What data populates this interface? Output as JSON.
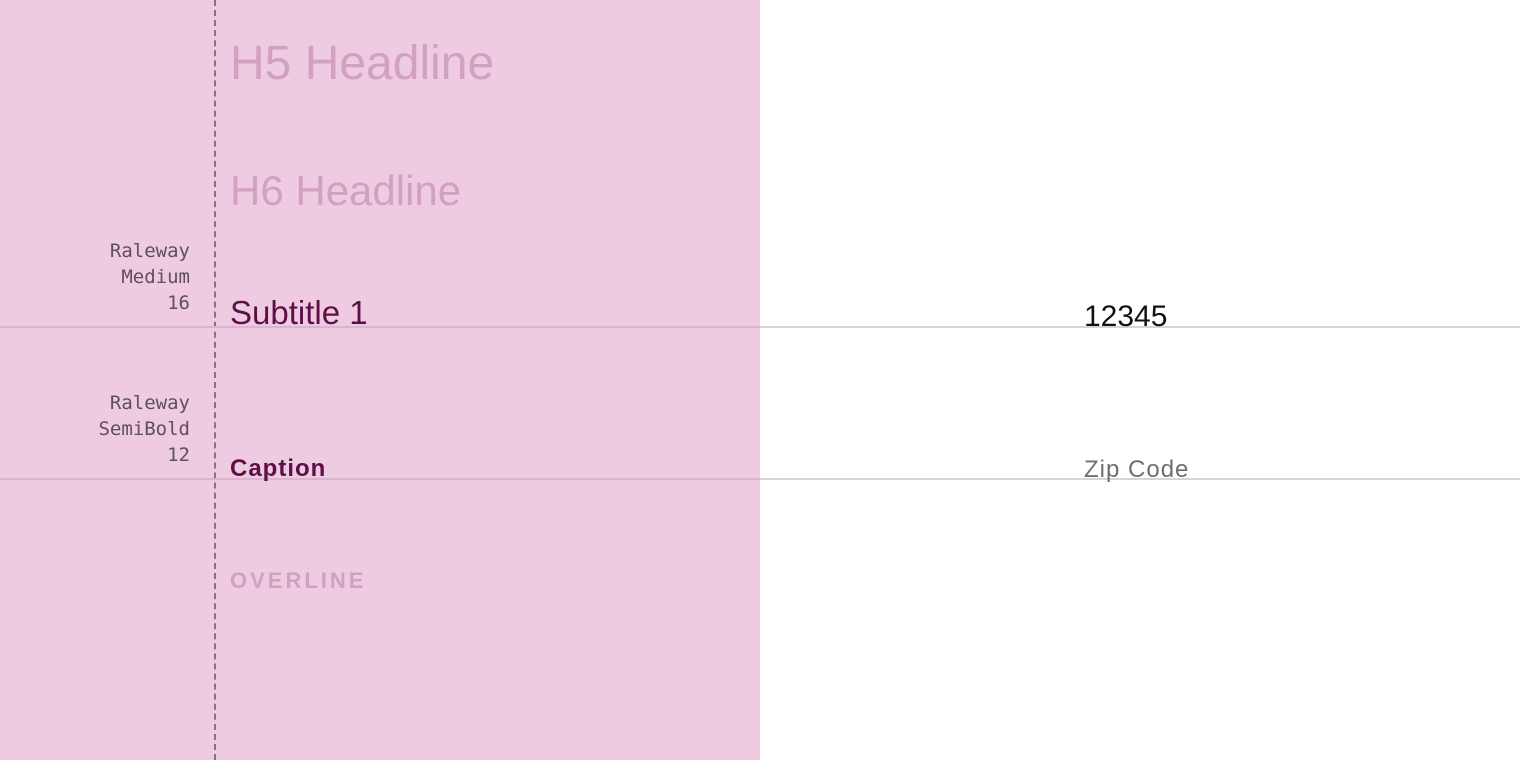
{
  "colors": {
    "panel_background": "#eecbe1",
    "faded_text": "#d2a1c2",
    "emphasized_text": "#5f0f47",
    "spec_text": "#5e5058",
    "guide_line": "#8a7080",
    "value_text": "#111111",
    "label_text": "#6f6f6f"
  },
  "type_scale": {
    "h5": "H5 Headline",
    "h6": "H6 Headline",
    "subtitle1": "Subtitle 1",
    "caption": "Caption",
    "overline": "OVERLINE"
  },
  "specs": {
    "subtitle1": {
      "family": "Raleway",
      "weight": "Medium",
      "size": "16"
    },
    "caption": {
      "family": "Raleway",
      "weight": "SemiBold",
      "size": "12"
    }
  },
  "demo": {
    "field_value": "12345",
    "field_label": "Zip Code"
  }
}
